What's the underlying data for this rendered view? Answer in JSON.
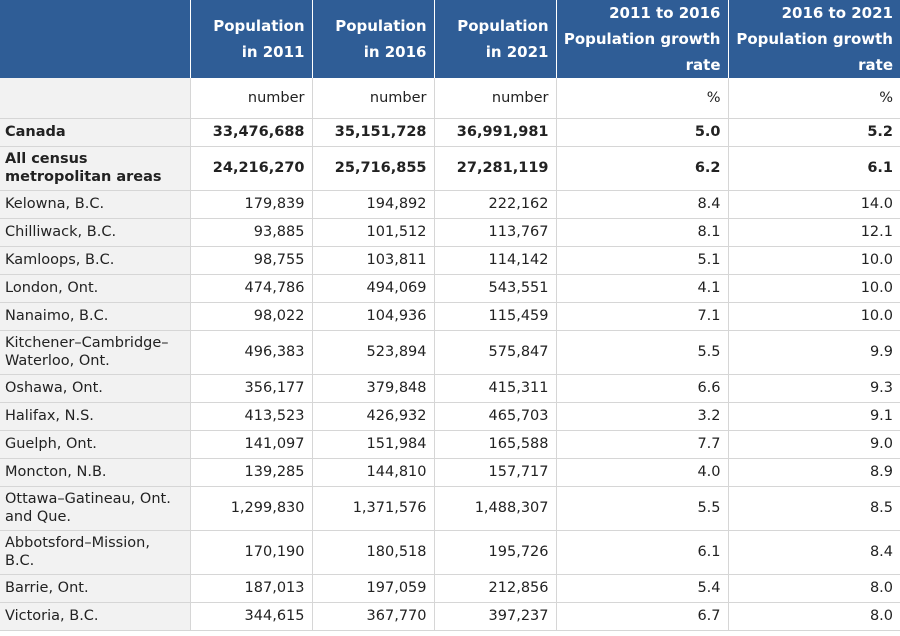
{
  "header": {
    "stub": "",
    "col1": "Population in 2011",
    "col2": "Population in 2016",
    "col3": "Population in 2021",
    "col4": "2011 to 2016 Population growth rate",
    "col5": "2016 to 2021 Population growth rate"
  },
  "units": {
    "stub": "",
    "col1": "number",
    "col2": "number",
    "col3": "number",
    "col4": "%",
    "col5": "%"
  },
  "rows": [
    {
      "name": "Canada",
      "p2011": "33,476,688",
      "p2016": "35,151,728",
      "p2021": "36,991,981",
      "g1116": "5.0",
      "g1621": "5.2"
    },
    {
      "name": "All census metropolitan areas",
      "p2011": "24,216,270",
      "p2016": "25,716,855",
      "p2021": "27,281,119",
      "g1116": "6.2",
      "g1621": "6.1"
    },
    {
      "name": "Kelowna, B.C.",
      "p2011": "179,839",
      "p2016": "194,892",
      "p2021": "222,162",
      "g1116": "8.4",
      "g1621": "14.0"
    },
    {
      "name": "Chilliwack, B.C.",
      "p2011": "93,885",
      "p2016": "101,512",
      "p2021": "113,767",
      "g1116": "8.1",
      "g1621": "12.1"
    },
    {
      "name": "Kamloops, B.C.",
      "p2011": "98,755",
      "p2016": "103,811",
      "p2021": "114,142",
      "g1116": "5.1",
      "g1621": "10.0"
    },
    {
      "name": "London, Ont.",
      "p2011": "474,786",
      "p2016": "494,069",
      "p2021": "543,551",
      "g1116": "4.1",
      "g1621": "10.0"
    },
    {
      "name": "Nanaimo, B.C.",
      "p2011": "98,022",
      "p2016": "104,936",
      "p2021": "115,459",
      "g1116": "7.1",
      "g1621": "10.0"
    },
    {
      "name": "Kitchener–Cambridge–Waterloo, Ont.",
      "p2011": "496,383",
      "p2016": "523,894",
      "p2021": "575,847",
      "g1116": "5.5",
      "g1621": "9.9"
    },
    {
      "name": "Oshawa, Ont.",
      "p2011": "356,177",
      "p2016": "379,848",
      "p2021": "415,311",
      "g1116": "6.6",
      "g1621": "9.3"
    },
    {
      "name": "Halifax, N.S.",
      "p2011": "413,523",
      "p2016": "426,932",
      "p2021": "465,703",
      "g1116": "3.2",
      "g1621": "9.1"
    },
    {
      "name": "Guelph, Ont.",
      "p2011": "141,097",
      "p2016": "151,984",
      "p2021": "165,588",
      "g1116": "7.7",
      "g1621": "9.0"
    },
    {
      "name": "Moncton, N.B.",
      "p2011": "139,285",
      "p2016": "144,810",
      "p2021": "157,717",
      "g1116": "4.0",
      "g1621": "8.9"
    },
    {
      "name": "Ottawa–Gatineau, Ont. and Que.",
      "p2011": "1,299,830",
      "p2016": "1,371,576",
      "p2021": "1,488,307",
      "g1116": "5.5",
      "g1621": "8.5"
    },
    {
      "name": "Abbotsford–Mission, B.C.",
      "p2011": "170,190",
      "p2016": "180,518",
      "p2021": "195,726",
      "g1116": "6.1",
      "g1621": "8.4"
    },
    {
      "name": "Barrie, Ont.",
      "p2011": "187,013",
      "p2016": "197,059",
      "p2021": "212,856",
      "g1116": "5.4",
      "g1621": "8.0"
    },
    {
      "name": "Victoria, B.C.",
      "p2011": "344,615",
      "p2016": "367,770",
      "p2021": "397,237",
      "g1116": "6.7",
      "g1621": "8.0"
    }
  ]
}
